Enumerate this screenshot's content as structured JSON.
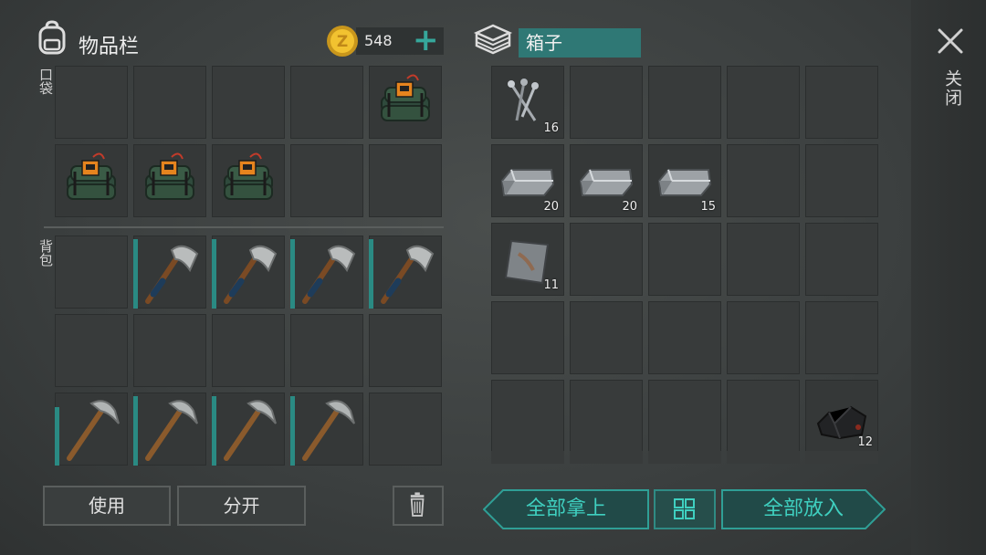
{
  "inventory": {
    "title": "物品栏",
    "coins": "548",
    "plus_label": "+",
    "pockets_label": "口袋",
    "backpack_label": "背包",
    "pockets": [
      {
        "item": null
      },
      {
        "item": null
      },
      {
        "item": null
      },
      {
        "item": null
      },
      {
        "item": "c4-explosive-icon"
      },
      {
        "item": "c4-explosive-icon"
      },
      {
        "item": "c4-explosive-icon"
      },
      {
        "item": "c4-explosive-icon"
      },
      {
        "item": null
      },
      {
        "item": null
      }
    ],
    "backpack": [
      {
        "item": null
      },
      {
        "item": "hatchet-icon",
        "durability": 0.95
      },
      {
        "item": "hatchet-icon",
        "durability": 0.95
      },
      {
        "item": "hatchet-icon",
        "durability": 0.95
      },
      {
        "item": "hatchet-icon",
        "durability": 0.95
      },
      {
        "item": null
      },
      {
        "item": null
      },
      {
        "item": null
      },
      {
        "item": null
      },
      {
        "item": null
      },
      {
        "item": "pickaxe-icon",
        "durability": 0.8
      },
      {
        "item": "pickaxe-icon",
        "durability": 0.95
      },
      {
        "item": "pickaxe-icon",
        "durability": 0.95
      },
      {
        "item": "pickaxe-icon",
        "durability": 0.95
      },
      {
        "item": null
      }
    ],
    "use_label": "使用",
    "split_label": "分开",
    "trash_icon": "trash-icon"
  },
  "box": {
    "title": "箱子",
    "slots": [
      {
        "item": "nails-icon",
        "qty": "16"
      },
      {
        "item": null
      },
      {
        "item": null
      },
      {
        "item": null
      },
      {
        "item": null
      },
      {
        "item": "iron-ingot-icon",
        "qty": "20"
      },
      {
        "item": "iron-ingot-icon",
        "qty": "20"
      },
      {
        "item": "iron-ingot-icon",
        "qty": "15"
      },
      {
        "item": null
      },
      {
        "item": null
      },
      {
        "item": "metal-plate-icon",
        "qty": "11"
      },
      {
        "item": null
      },
      {
        "item": null
      },
      {
        "item": null
      },
      {
        "item": null
      },
      {
        "item": null
      },
      {
        "item": null
      },
      {
        "item": null
      },
      {
        "item": null
      },
      {
        "item": null
      },
      {
        "item": null
      },
      {
        "item": null
      },
      {
        "item": null
      },
      {
        "item": null
      },
      {
        "item": "coal-icon",
        "qty": "12"
      }
    ],
    "take_all_label": "全部拿上",
    "put_all_label": "全部放入"
  },
  "close_label": "关闭",
  "colors": {
    "accent": "#36a79b",
    "durability": "#2a8a83",
    "title_bg": "#2f7875"
  }
}
